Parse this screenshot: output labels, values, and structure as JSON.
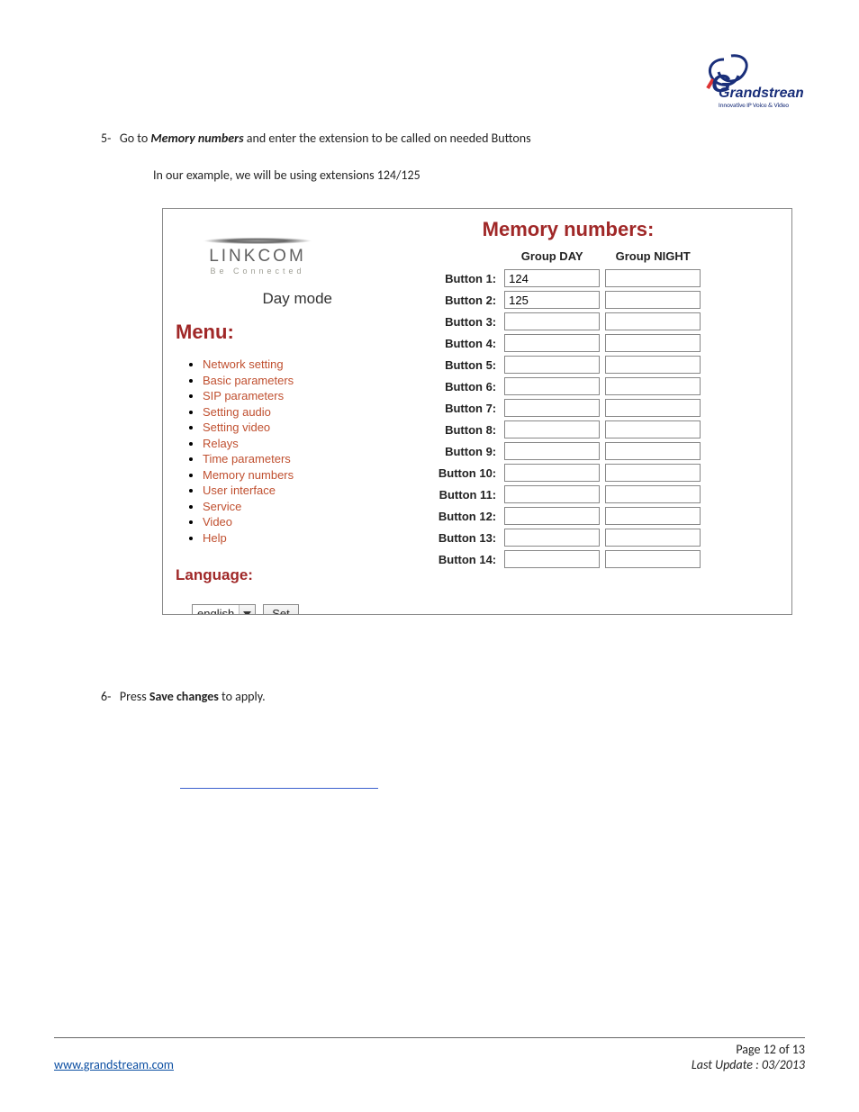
{
  "logo": {
    "brand": "Grandstream",
    "tagline": "Innovative IP Voice & Video"
  },
  "step5": {
    "num": "5-",
    "pre": "Go to ",
    "bold": "Memory numbers",
    "post": " and enter the extension to be called on needed Buttons",
    "sub": "In our example, we will be using extensions 124/125"
  },
  "step6": {
    "num": "6-",
    "pre": "Press ",
    "bold": "Save changes",
    "post": " to apply."
  },
  "screenshot": {
    "sidebar": {
      "logo_text": "LINKCOM",
      "logo_tag": "Be Connected",
      "mode": "Day mode",
      "menu_title": "Menu:",
      "items": [
        "Network setting",
        "Basic parameters",
        "SIP parameters",
        "Setting audio",
        "Setting video",
        "Relays",
        "Time parameters",
        "Memory numbers",
        "User interface",
        "Service",
        "Video",
        "Help"
      ],
      "language_title": "Language:",
      "language_value": "english",
      "set_button": "Set"
    },
    "content": {
      "title": "Memory numbers:",
      "col_day": "Group DAY",
      "col_night": "Group NIGHT",
      "rows": [
        {
          "label": "Button 1:",
          "day": "124",
          "night": ""
        },
        {
          "label": "Button 2:",
          "day": "125",
          "night": ""
        },
        {
          "label": "Button 3:",
          "day": "",
          "night": ""
        },
        {
          "label": "Button 4:",
          "day": "",
          "night": ""
        },
        {
          "label": "Button 5:",
          "day": "",
          "night": ""
        },
        {
          "label": "Button 6:",
          "day": "",
          "night": ""
        },
        {
          "label": "Button 7:",
          "day": "",
          "night": ""
        },
        {
          "label": "Button 8:",
          "day": "",
          "night": ""
        },
        {
          "label": "Button 9:",
          "day": "",
          "night": ""
        },
        {
          "label": "Button 10:",
          "day": "",
          "night": ""
        },
        {
          "label": "Button 11:",
          "day": "",
          "night": ""
        },
        {
          "label": "Button 12:",
          "day": "",
          "night": ""
        },
        {
          "label": "Button 13:",
          "day": "",
          "night": ""
        },
        {
          "label": "Button 14:",
          "day": "",
          "night": ""
        }
      ]
    }
  },
  "footer": {
    "url": "www.grandstream.com",
    "page": "Page 12 of 13",
    "updated": "Last Update : 03/2013"
  }
}
